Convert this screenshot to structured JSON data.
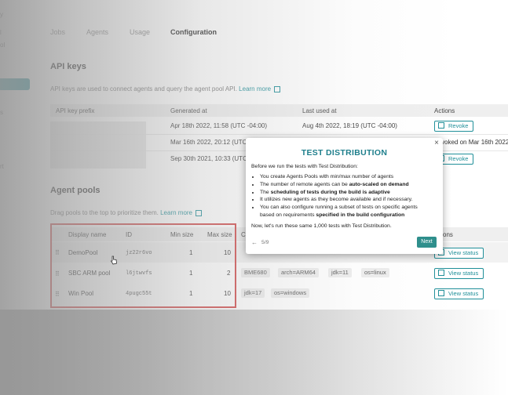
{
  "sidebar": {
    "fragments": [
      "y",
      "l",
      "ol",
      "s",
      "rt"
    ]
  },
  "tabs": [
    {
      "label": "Jobs"
    },
    {
      "label": "Agents"
    },
    {
      "label": "Usage"
    },
    {
      "label": "Configuration"
    }
  ],
  "api_keys": {
    "title": "API keys",
    "description": "API keys are used to connect agents and query the agent pool API.",
    "learn_more": "Learn more",
    "columns": [
      "API key prefix",
      "Generated at",
      "Last used at",
      "Actions"
    ],
    "rows": [
      {
        "generated": "Apr 18th 2022, 11:58 (UTC -04:00)",
        "last_used": "Aug 4th 2022, 18:19 (UTC -04:00)",
        "action": "Revoke"
      },
      {
        "generated": "Mar 16th 2022, 20:12 (UTC",
        "last_used": "",
        "action": "voked on Mar 16th 2022"
      },
      {
        "generated": "Sep 30th 2021, 10:33 (UTC",
        "last_used": "",
        "action": "Revoke"
      }
    ]
  },
  "agent_pools": {
    "title": "Agent pools",
    "description": "Drag pools to the top to prioritize them.",
    "learn_more": "Learn more",
    "columns": [
      "Display name",
      "ID",
      "Min size",
      "Max size",
      "C",
      "tions"
    ],
    "rows": [
      {
        "name": "DemoPool",
        "id": "jz22r6vo",
        "min": "1",
        "max": "10",
        "chips": [],
        "action": "View status"
      },
      {
        "name": "SBC ARM pool",
        "id": "l6jtwvfs",
        "min": "1",
        "max": "2",
        "chips": [
          "BME680",
          "arch=ARM64",
          "jdk=11",
          "os=linux"
        ],
        "action": "View status"
      },
      {
        "name": "Win Pool",
        "id": "4pugc55t",
        "min": "1",
        "max": "10",
        "chips": [
          "jdk=17",
          "os=windows"
        ],
        "action": "View status"
      }
    ]
  },
  "popover": {
    "title": "TEST DISTRIBUTION",
    "close": "×",
    "intro": "Before we run the tests with Test Distribution:",
    "bullet1": "You create Agents Pools with min/max number of agents",
    "bullet2_pre": "The number of remote agents can be ",
    "bullet2_bold": "auto-scaled on demand",
    "bullet3_pre": "The ",
    "bullet3_bold": "scheduling of tests during the build is adaptive",
    "bullet4": "It utilizes new agents as they become available and if necessary.",
    "bullet5_line1": "You can also configure running a subset of tests on specific agents",
    "bullet5_line2_pre": "based on requirements ",
    "bullet5_line2_bold": "specified in the build configuration",
    "outro": "Now, let's run these same 1,000 tests with Test Distribution.",
    "back": "←",
    "step": "5/9",
    "next": "Next"
  },
  "colors": {
    "accent": "#1f8f99",
    "highlight_border": "#d04848",
    "next_button": "#2f8f8c"
  }
}
